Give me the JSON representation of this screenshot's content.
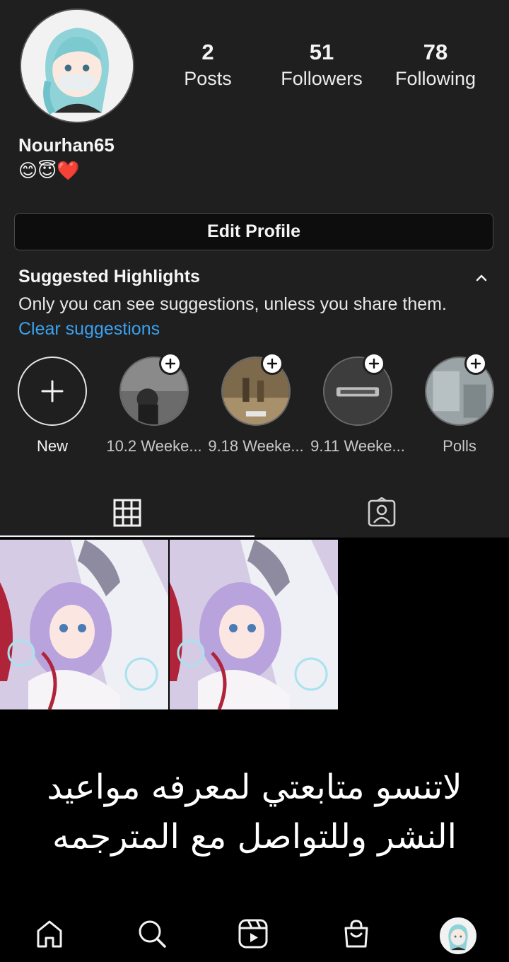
{
  "profile": {
    "username": "Nourhan65",
    "bio": "😊😇❤️",
    "stats": [
      {
        "value": "2",
        "label": "Posts"
      },
      {
        "value": "51",
        "label": "Followers"
      },
      {
        "value": "78",
        "label": "Following"
      }
    ],
    "edit_button_label": "Edit Profile"
  },
  "suggested_highlights": {
    "title": "Suggested Highlights",
    "description": "Only you can see suggestions, unless you share them.",
    "clear_label": "Clear suggestions",
    "items": [
      {
        "label": "New"
      },
      {
        "label": "10.2 Weeke..."
      },
      {
        "label": "9.18 Weeke..."
      },
      {
        "label": "9.11 Weeke..."
      },
      {
        "label": "Polls"
      }
    ]
  },
  "tabs": [
    {
      "name": "grid-icon",
      "active": true
    },
    {
      "name": "tagged-icon",
      "active": false
    }
  ],
  "overlay": {
    "line1": "لاتنسو متابعتي لمعرفه مواعيد",
    "line2": "النشر وللتواصل مع المترجمه"
  },
  "bottom_nav": [
    "home-icon",
    "search-icon",
    "reels-icon",
    "shop-icon",
    "profile-avatar"
  ],
  "colors": {
    "accent_link": "#3ba1ee",
    "panel_bg": "#1f1f1f",
    "page_bg": "#000000"
  }
}
